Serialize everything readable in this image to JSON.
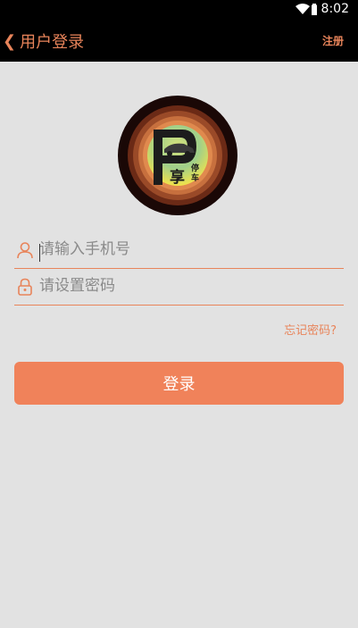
{
  "status_bar": {
    "time": "8:02",
    "icons": [
      "wifi-icon",
      "battery-icon"
    ]
  },
  "app_bar": {
    "back_icon": "❮",
    "title": "用户登录",
    "register_label": "注册"
  },
  "logo": {
    "letter": "P",
    "char_main": "享",
    "char_side_1": "停",
    "char_side_2": "车"
  },
  "form": {
    "phone_placeholder": "请输入手机号",
    "phone_value": "",
    "password_placeholder": "请设置密码",
    "password_value": "",
    "forgot_label": "忘记密码?"
  },
  "login_button_label": "登录",
  "colors": {
    "accent": "#f0825a",
    "bar": "#000000",
    "background": "#e2e2e2"
  }
}
